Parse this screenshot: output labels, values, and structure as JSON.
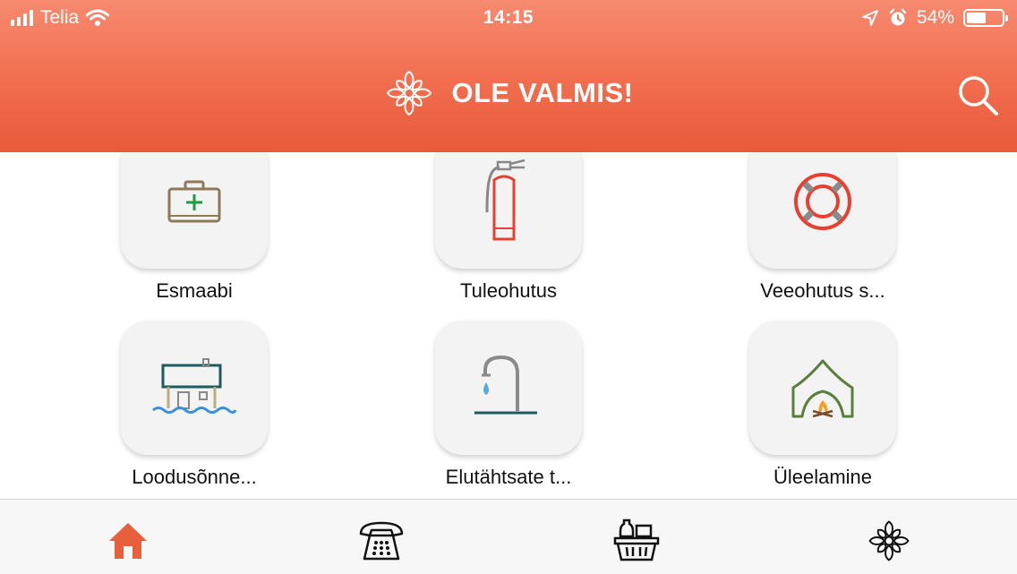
{
  "status_bar": {
    "carrier": "Telia",
    "time": "14:15",
    "battery": "54%",
    "battery_level": 0.54,
    "icons": [
      "signal-bars-icon",
      "wifi-icon",
      "location-arrow-icon",
      "alarm-clock-icon",
      "battery-icon"
    ]
  },
  "header": {
    "title": "OLE VALMIS!",
    "logo_icon": "ornament-flower-icon",
    "search_icon": "search-icon"
  },
  "tiles": [
    {
      "label": "Esmaabi",
      "icon": "first-aid-kit-icon"
    },
    {
      "label": "Tuleohutus",
      "icon": "fire-extinguisher-icon"
    },
    {
      "label": "Veeohutus s...",
      "icon": "life-ring-icon"
    },
    {
      "label": "Loodusõnne...",
      "icon": "flooded-house-icon"
    },
    {
      "label": "Elutähtsate t...",
      "icon": "water-tap-icon"
    },
    {
      "label": "Üleelamine",
      "icon": "tent-campfire-icon"
    }
  ],
  "tabbar": {
    "tabs": [
      {
        "icon": "home-icon",
        "active": true
      },
      {
        "icon": "telephone-icon",
        "active": false
      },
      {
        "icon": "supply-basket-icon",
        "active": false
      },
      {
        "icon": "ornament-flower-icon",
        "active": false
      }
    ]
  },
  "colors": {
    "header_top": "#f78a6f",
    "header_bottom": "#e85a3a",
    "active_tab": "#e85f3c"
  }
}
